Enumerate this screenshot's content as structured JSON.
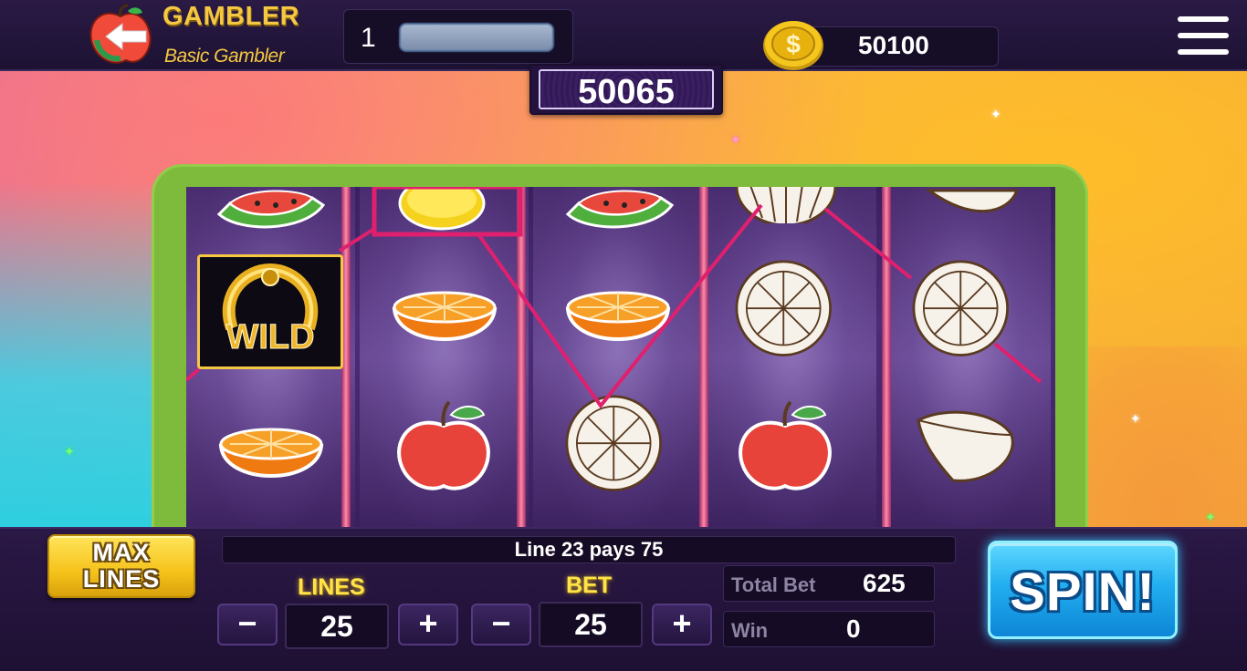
{
  "header": {
    "app_title": "GAMBLER",
    "rank": "Basic Gambler",
    "level": "1",
    "xp_progress": 1.0,
    "coins": "50100"
  },
  "last_win_display": "50065",
  "reels": [
    [
      "watermelon-icon",
      "wild-icon",
      "orange-half-icon"
    ],
    [
      "lemon-icon",
      "orange-half-icon",
      "apple-icon"
    ],
    [
      "watermelon-icon",
      "orange-half-icon",
      "orange-slice-icon"
    ],
    [
      "onion-icon",
      "orange-slice-icon",
      "apple-icon"
    ],
    [
      "lemon-wedge-icon",
      "orange-slice-icon",
      "lemon-wedge-icon"
    ]
  ],
  "controls": {
    "max_lines_label_1": "MAX",
    "max_lines_label_2": "LINES",
    "message": "Line 23 pays 75",
    "lines_label": "LINES",
    "lines_value": "25",
    "bet_label": "BET",
    "bet_value": "25",
    "minus": "−",
    "plus": "+",
    "total_bet_label": "Total Bet",
    "total_bet_value": "625",
    "win_label": "Win",
    "win_value": "0",
    "spin_label": "SPIN!"
  },
  "colors": {
    "accent_gold": "#f5c842",
    "payline": "#e0206e",
    "frame_green": "#7ebb3c",
    "spin_blue": "#22aef0"
  }
}
